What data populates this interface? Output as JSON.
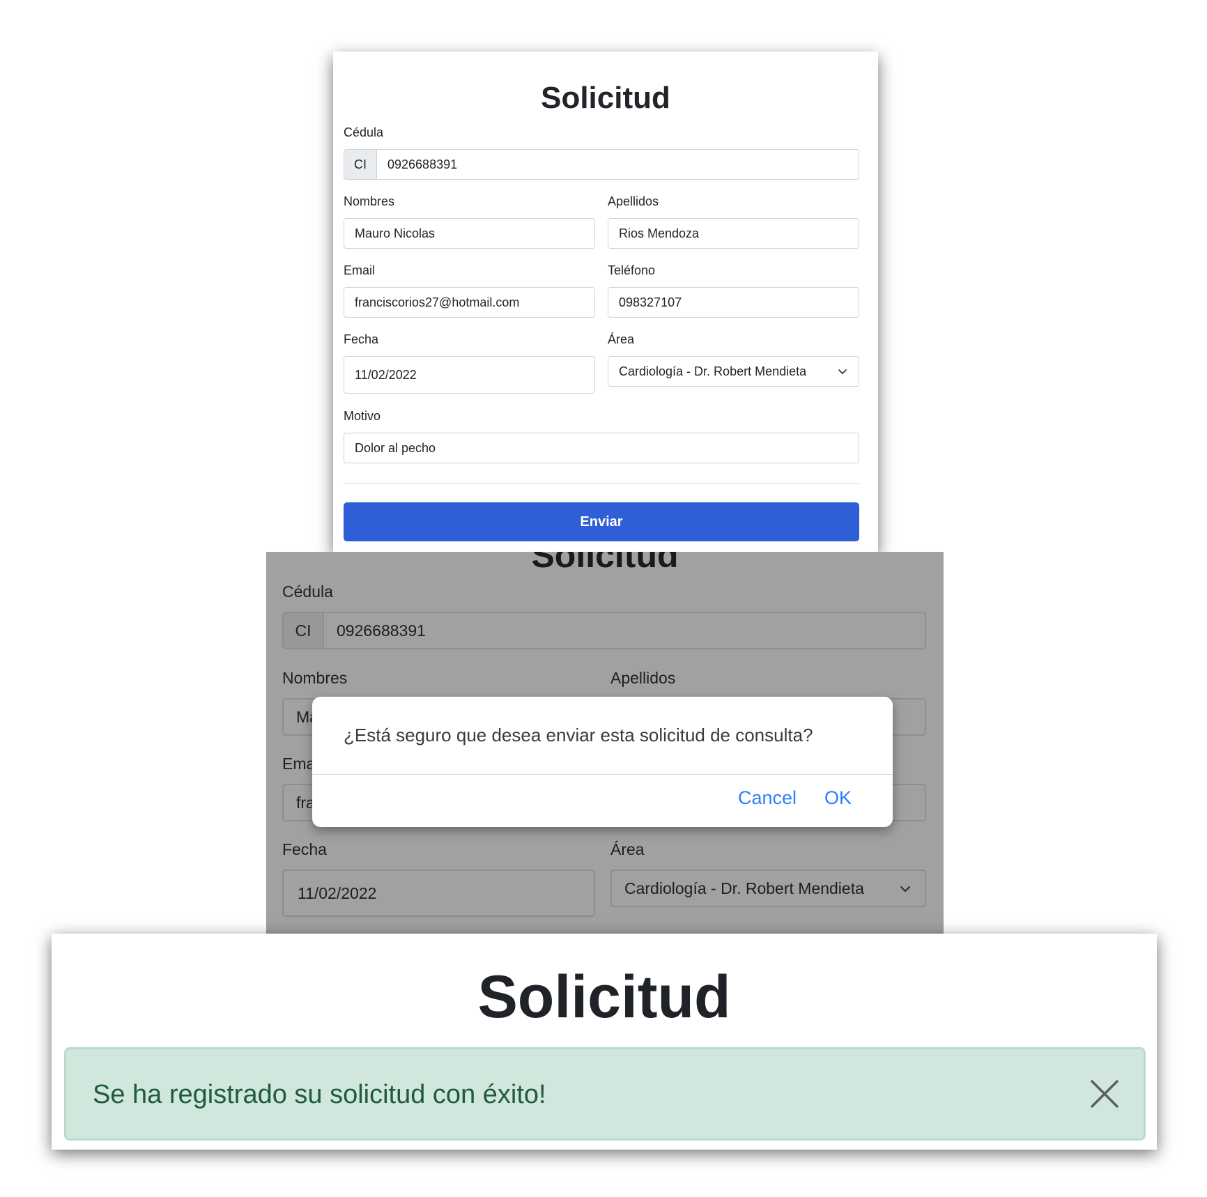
{
  "form": {
    "title": "Solicitud",
    "cedula_label": "Cédula",
    "cedula_prefix": "CI",
    "cedula_value": "0926688391",
    "nombres_label": "Nombres",
    "nombres_value": "Mauro Nicolas",
    "apellidos_label": "Apellidos",
    "apellidos_value": "Rios Mendoza",
    "email_label": "Email",
    "email_value": "franciscorios27@hotmail.com",
    "telefono_label": "Teléfono",
    "telefono_value": "098327107",
    "fecha_label": "Fecha",
    "fecha_value": "11/02/2022",
    "area_label": "Área",
    "area_value": "Cardiología - Dr. Robert Mendieta",
    "motivo_label": "Motivo",
    "motivo_value": "Dolor al pecho",
    "submit_label": "Enviar"
  },
  "confirm_view": {
    "title": "Solicitud",
    "cedula_label": "Cédula",
    "cedula_prefix": "CI",
    "cedula_value": "0926688391",
    "nombres_label": "Nombres",
    "nombres_partial": "Ma",
    "apellidos_label": "Apellidos",
    "email_label_partial": "Ema",
    "email_partial": "fra",
    "fecha_label": "Fecha",
    "fecha_value": "11/02/2022",
    "area_label": "Área",
    "area_value": "Cardiología - Dr. Robert Mendieta",
    "dialog": {
      "message": "¿Está seguro que desea enviar esta solicitud de consulta?",
      "cancel_label": "Cancel",
      "ok_label": "OK"
    }
  },
  "success_view": {
    "title": "Solicitud",
    "alert_message": "Se ha registrado su solicitud con éxito!",
    "close_icon": "close-icon"
  },
  "colors": {
    "primary_button": "#2f5fd6",
    "dialog_link": "#2d7ff9",
    "success_bg": "#d1e7dd",
    "success_text": "#1f5b3e",
    "overlay": "#a1a1a1"
  }
}
